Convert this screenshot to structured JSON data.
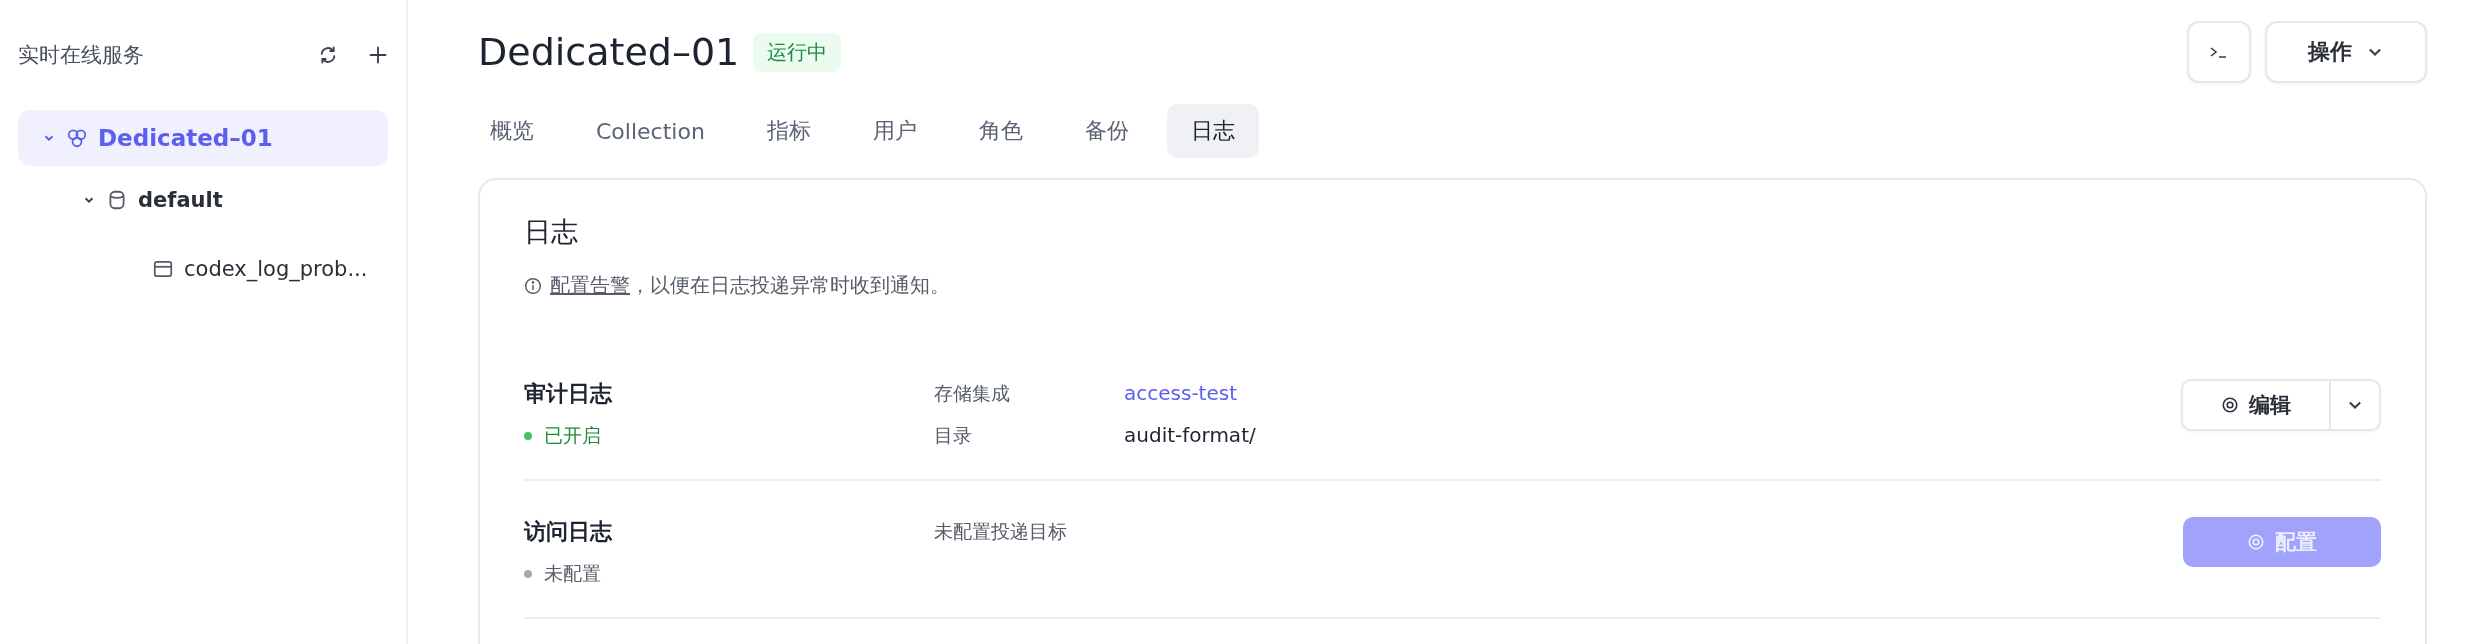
{
  "sidebar": {
    "title": "实时在线服务",
    "tree": [
      {
        "label": "Dedicated–01",
        "kind": "cluster",
        "selected": true,
        "expanded": true,
        "children": [
          {
            "label": "default",
            "kind": "database",
            "selected": false,
            "expanded": true,
            "children": [
              {
                "label": "codex_log_prob...",
                "kind": "table",
                "selected": false
              }
            ]
          }
        ]
      }
    ]
  },
  "header": {
    "title": "Dedicated–01",
    "status": "运行中",
    "actions_button": "操作"
  },
  "tabs": [
    {
      "label": "概览",
      "selected": false
    },
    {
      "label": "Collection",
      "selected": false
    },
    {
      "label": "指标",
      "selected": false
    },
    {
      "label": "用户",
      "selected": false
    },
    {
      "label": "角色",
      "selected": false
    },
    {
      "label": "备份",
      "selected": false
    },
    {
      "label": "日志",
      "selected": true
    }
  ],
  "panel": {
    "title": "日志",
    "notice": {
      "link": "配置告警",
      "text": "，以便在日志投递异常时收到通知。"
    },
    "logs": [
      {
        "name": "审计日志",
        "status": "已开启",
        "color": "#3fc26b",
        "fields": [
          {
            "label": "存储集成",
            "value": "access-test",
            "link": true
          },
          {
            "label": "目录",
            "value": "audit-format/",
            "link": false
          }
        ],
        "action": {
          "kind": "split",
          "label": "编辑",
          "disabled": false
        }
      },
      {
        "name": "访问日志",
        "status": "未配置",
        "color": "#a3a9b6",
        "note": "未配置投递目标",
        "action": {
          "kind": "primary",
          "label": "配置",
          "disabled": true
        }
      }
    ]
  }
}
